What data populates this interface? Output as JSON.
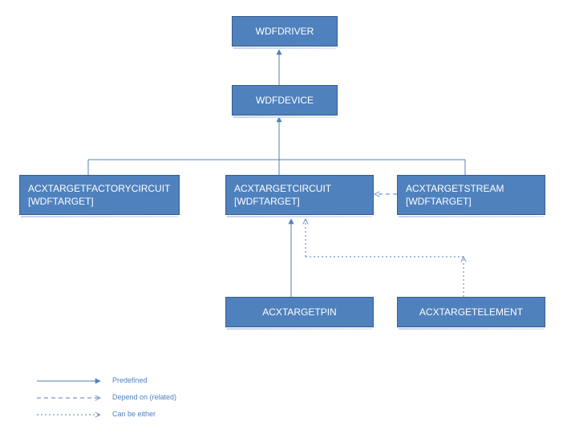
{
  "nodes": {
    "wdfdriver": "WDFDRIVER",
    "wdfdevice": "WDFDEVICE",
    "factorycircuit_line1": "ACXTARGETFACTORYCIRCUIT",
    "factorycircuit_line2": "[WDFTARGET]",
    "targetcircuit_line1": "ACXTARGETCIRCUIT",
    "targetcircuit_line2": "[WDFTARGET]",
    "targetstream_line1": "ACXTARGETSTREAM",
    "targetstream_line2": "[WDFTARGET]",
    "targetpin": "ACXTARGETPIN",
    "targetelement": "ACXTARGETELEMENT"
  },
  "legend": {
    "predefined": "Predefined",
    "depend": "Depend on (related)",
    "either": "Can be either"
  },
  "colors": {
    "fill": "#4f81bd",
    "line": "#4f81bd"
  }
}
